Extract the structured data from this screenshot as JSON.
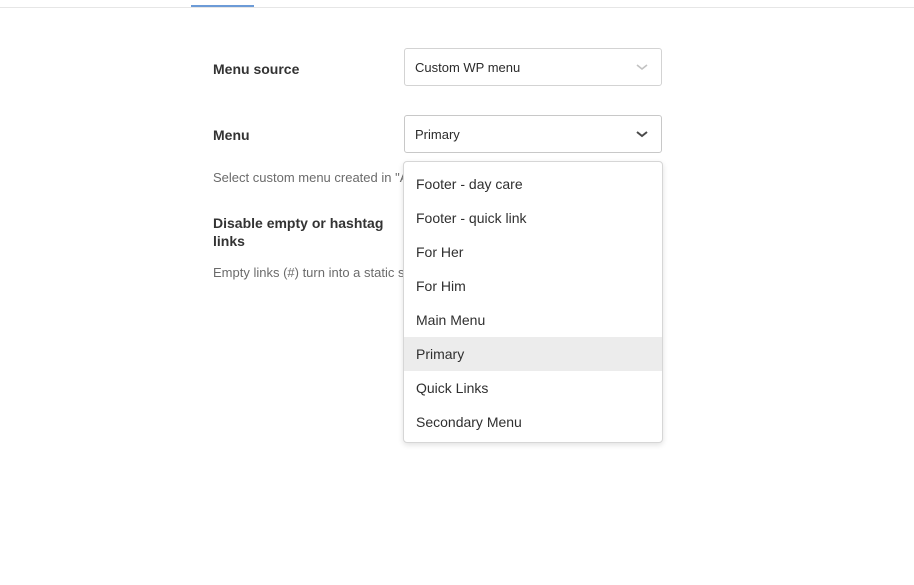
{
  "settings": {
    "menu_source": {
      "label": "Menu source",
      "value": "Custom WP menu"
    },
    "menu": {
      "label": "Menu",
      "value": "Primary",
      "help": "Select custom menu created in \"A"
    },
    "disable_links": {
      "label_line1": "Disable empty or hashtag",
      "label_line2": "links",
      "help": "Empty links (#) turn into a static s"
    }
  },
  "dropdown": {
    "options": [
      "Footer - day care",
      "Footer - quick link",
      "For Her",
      "For Him",
      "Main Menu",
      "Primary",
      "Quick Links",
      "Secondary Menu"
    ],
    "selected": "Primary"
  },
  "colors": {
    "tab_accent": "#6c9bd7",
    "selected_bg": "#ececec"
  }
}
